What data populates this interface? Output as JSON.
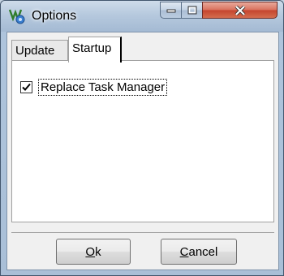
{
  "window": {
    "title": "Options",
    "icon": "wrench-gear-icon",
    "controls": {
      "minimize": "minimize-icon",
      "maximize": "maximize-icon",
      "close": "close-icon"
    }
  },
  "tabs": [
    {
      "label": "Update",
      "selected": false
    },
    {
      "label": "Startup",
      "selected": true
    }
  ],
  "startup": {
    "replace_task_manager": {
      "label": "Replace Task Manager",
      "checked": true
    }
  },
  "buttons": {
    "ok": {
      "mnemonic": "O",
      "rest": "k"
    },
    "cancel": {
      "mnemonic": "C",
      "rest": "ancel"
    }
  },
  "colors": {
    "close_button": "#c4432d",
    "titlebar": "#b6c9de"
  }
}
